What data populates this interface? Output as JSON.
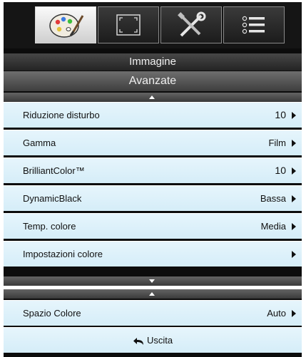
{
  "tabs": [
    {
      "name": "Immagine",
      "icon": "palette-icon",
      "active": true
    },
    {
      "name": "Schermo",
      "icon": "screen-resize-icon",
      "active": false
    },
    {
      "name": "Impostazioni",
      "icon": "tools-icon",
      "active": false
    },
    {
      "name": "Opzioni",
      "icon": "list-icon",
      "active": false
    }
  ],
  "menu": {
    "title": "Immagine",
    "subtitle": "Avanzate",
    "items": [
      {
        "label": "Riduzione disturbo",
        "value": "10"
      },
      {
        "label": "Gamma",
        "value": "Film"
      },
      {
        "label": "BrilliantColor™",
        "value": "10"
      },
      {
        "label": "DynamicBlack",
        "value": "Bassa"
      },
      {
        "label": "Temp. colore",
        "value": "Media"
      },
      {
        "label": "Impostazioni colore",
        "value": ""
      }
    ]
  },
  "page2": {
    "items": [
      {
        "label": "Spazio Colore",
        "value": "Auto"
      }
    ],
    "exit_label": "Uscita"
  },
  "colors": {
    "row_bg": "#dff2fa",
    "osd_bg": "#0c0c0c",
    "text": "#111111"
  }
}
